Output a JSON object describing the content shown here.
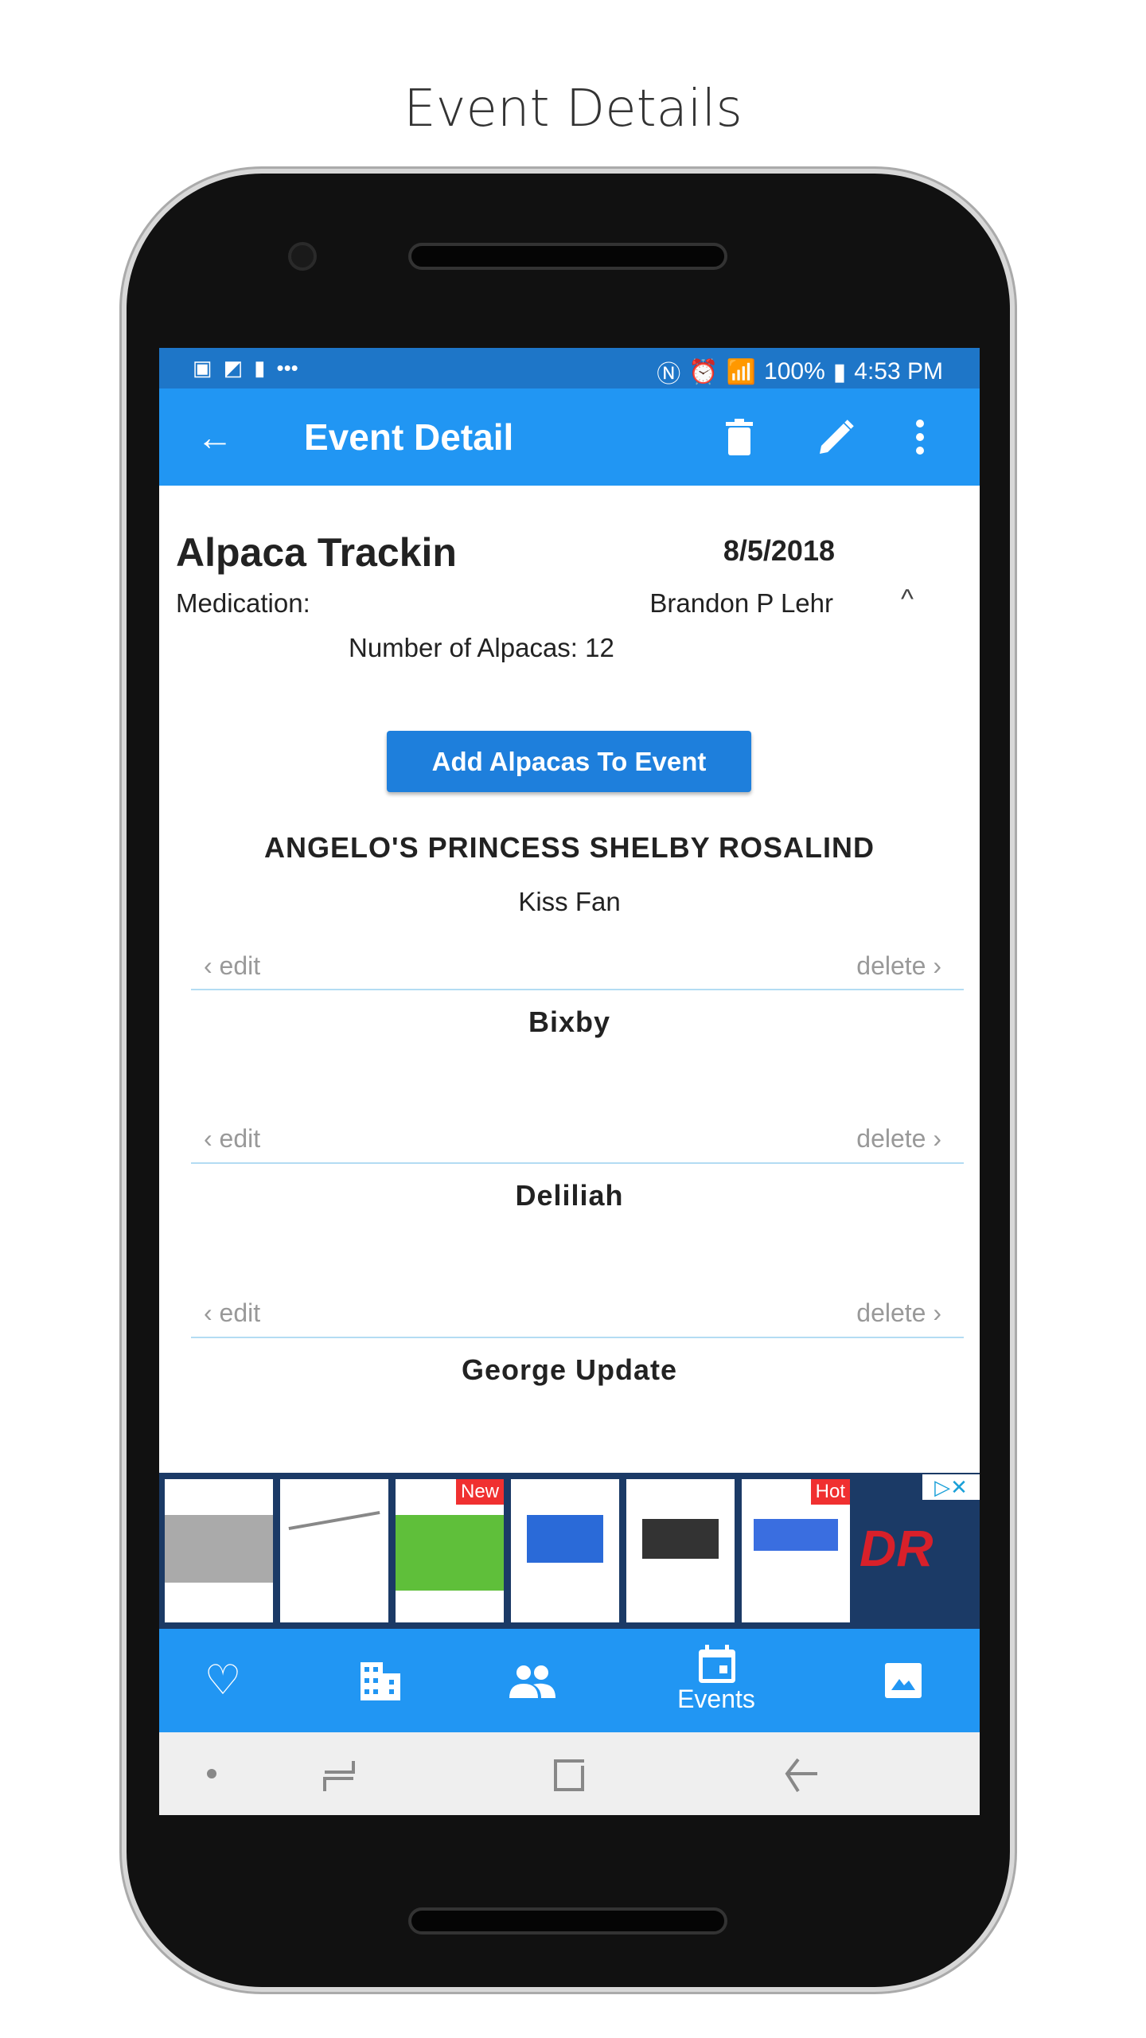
{
  "page_title": "Event Details",
  "status_bar": {
    "left_icons": [
      "image-icon",
      "activity-icon",
      "battery-100-icon",
      "more-dots-icon"
    ],
    "battery": "100%",
    "time": "4:53 PM"
  },
  "app_bar": {
    "title": "Event Detail",
    "icons": [
      "back-arrow-icon",
      "trash-icon",
      "pencil-icon",
      "more-vert-icon"
    ]
  },
  "event": {
    "name": "Alpaca Trackin",
    "date": "8/5/2018",
    "type_label": "Medication:",
    "person": "Brandon P Lehr",
    "alpaca_count": "Number of Alpacas: 12"
  },
  "add_button": "Add Alpacas To Event",
  "alpacas": [
    {
      "name": "ANGELO'S PRINCESS SHELBY ROSALIND",
      "subtitle": "Kiss Fan"
    },
    {
      "name": "Bixby",
      "subtitle": ""
    },
    {
      "name": "Deliliah",
      "subtitle": ""
    },
    {
      "name": "George Update",
      "subtitle": ""
    }
  ],
  "swipe": {
    "edit": "edit",
    "delete": "delete"
  },
  "ad": {
    "tags": [
      "New",
      "Hot"
    ],
    "brand": "DR"
  },
  "bottom_nav": [
    {
      "icon": "heart-icon",
      "label": ""
    },
    {
      "icon": "building-icon",
      "label": ""
    },
    {
      "icon": "people-icon",
      "label": ""
    },
    {
      "icon": "calendar-icon",
      "label": "Events"
    },
    {
      "icon": "image-icon",
      "label": ""
    }
  ],
  "colors": {
    "primary": "#2196f3",
    "status": "#1e76c8",
    "button": "#1e7fdc",
    "divider": "#b3dcf3"
  }
}
